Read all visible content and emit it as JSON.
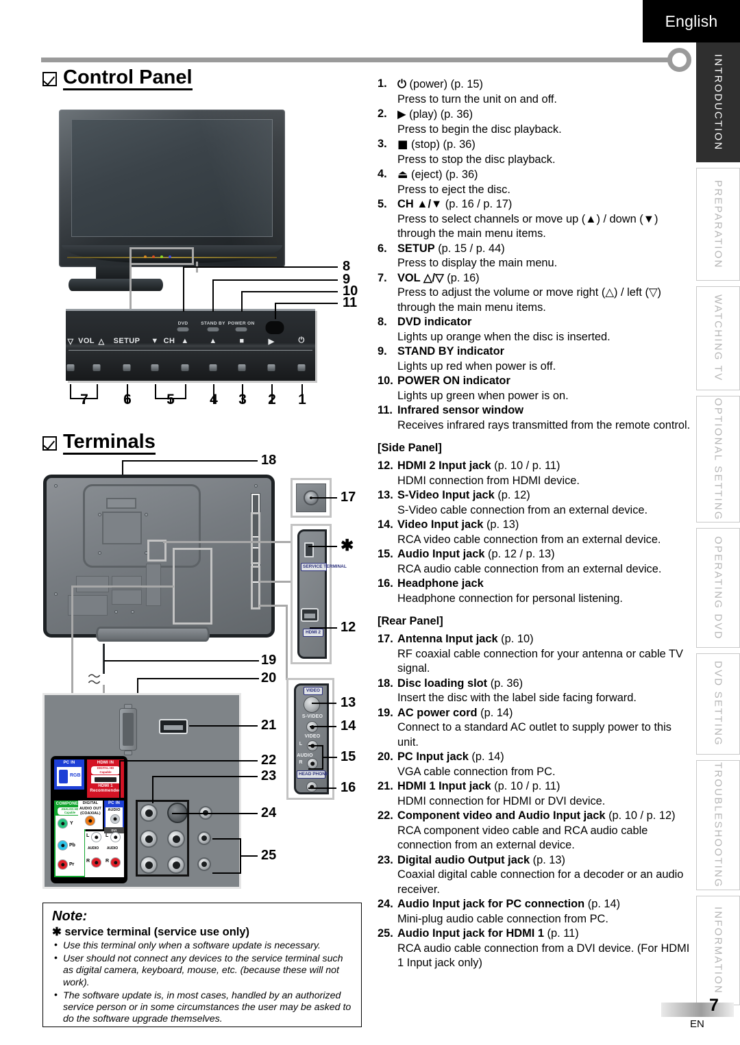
{
  "header": {
    "language": "English"
  },
  "rail": {
    "tabs": [
      {
        "label": "INTRODUCTION",
        "active": true
      },
      {
        "label": "PREPARATION",
        "active": false
      },
      {
        "label": "WATCHING TV",
        "active": false
      },
      {
        "label": "OPTIONAL  SETTING",
        "active": false
      },
      {
        "label": "OPERATING DVD",
        "active": false
      },
      {
        "label": "DVD SETTING",
        "active": false
      },
      {
        "label": "TROUBLESHOOTING",
        "active": false
      },
      {
        "label": "INFORMATION",
        "active": false
      }
    ]
  },
  "sections": {
    "control_panel_title": "Control Panel",
    "terminals_title": "Terminals"
  },
  "control_panel_diagram": {
    "button_labels": [
      "VOL",
      "SETUP",
      "CH"
    ],
    "vol_down_glyph": "▽",
    "vol_up_glyph": "△",
    "setup_label": "SETUP",
    "ch_down_glyph": "▼",
    "ch_label": "CH",
    "ch_up_glyph": "▲",
    "eject_glyph": "▲",
    "stop_glyph": "■",
    "play_glyph": "▶",
    "power_glyph": "⏻",
    "indicators": [
      "DVD",
      "STAND BY",
      "POWER ON"
    ],
    "bottom_numbers": [
      "7",
      "6",
      "5",
      "4",
      "3",
      "2",
      "1"
    ],
    "right_callouts": [
      "8",
      "9",
      "10",
      "11"
    ]
  },
  "terminals_diagram": {
    "callouts": [
      "18",
      "17",
      "19",
      "20",
      "13",
      "14",
      "15",
      "16",
      "12",
      "21",
      "22",
      "23",
      "24",
      "25"
    ],
    "asterisk": "✱",
    "side_tags": [
      "SERVICE TERMINAL",
      "HDMI 2",
      "VIDEO",
      "HEAD PHONE"
    ],
    "side_labels": [
      "S-VIDEO",
      "VIDEO",
      "AUDIO",
      "L",
      "R"
    ],
    "sticker": {
      "pc_in": "PC IN",
      "rgb": "RGB",
      "hdmi_in": "HDMI IN",
      "hdmi_sub": "DIGITAL HD Capable",
      "hdmi_1": "HDMI 1",
      "recommended": "Recommended",
      "component": "COMPONENT",
      "component_sub": "ANALOG HD Capable",
      "digital_audio_out": "DIGITAL AUDIO OUT (COAXIAL)",
      "pc_in_audio_hd": "PC IN",
      "audio": "AUDIO",
      "analog_audio": "DVI ANALOG AUDIO",
      "y": "Y",
      "pb": "Pb",
      "pr": "Pr",
      "l": "L",
      "r": "R",
      "audio_small": "AUDIO"
    }
  },
  "list": {
    "items": [
      {
        "num": "1.",
        "title": "⏻",
        "title_is_glyph": true,
        "suffix": " (power) (p. 15)",
        "desc": "Press to turn the unit on and off."
      },
      {
        "num": "2.",
        "title": "▶",
        "title_is_glyph": true,
        "suffix": " (play) (p. 36)",
        "desc": "Press to begin the disc playback."
      },
      {
        "num": "3.",
        "title": "■",
        "title_is_glyph": true,
        "suffix": " (stop) (p. 36)",
        "desc": "Press to stop the disc playback."
      },
      {
        "num": "4.",
        "title": "⏏",
        "title_is_glyph": true,
        "suffix": " (eject) (p. 36)",
        "desc": "Press to eject the disc."
      },
      {
        "num": "5.",
        "title": "CH ▲/▼",
        "suffix": " (p. 16 / p. 17)",
        "desc": "Press to select channels or move up (▲) / down (▼) through the main menu items."
      },
      {
        "num": "6.",
        "title": "SETUP",
        "suffix": " (p. 15 / p. 44)",
        "desc": "Press to display the main menu."
      },
      {
        "num": "7.",
        "title": "VOL △/▽",
        "suffix": " (p. 16)",
        "desc": "Press to adjust the volume or move right (△) / left (▽) through the main menu items."
      },
      {
        "num": "8.",
        "title": "DVD indicator",
        "suffix": "",
        "desc": "Lights up orange when the disc is inserted."
      },
      {
        "num": "9.",
        "title": "STAND BY indicator",
        "suffix": "",
        "desc": "Lights up red when power is off."
      },
      {
        "num": "10.",
        "title": "POWER ON indicator",
        "suffix": "",
        "desc": "Lights up green when power is on."
      },
      {
        "num": "11.",
        "title": "Infrared sensor window",
        "suffix": "",
        "desc": "Receives infrared rays transmitted from the remote control."
      }
    ],
    "side_panel_heading": "[Side Panel]",
    "side_items": [
      {
        "num": "12.",
        "title": "HDMI 2 Input jack",
        "suffix": " (p. 10 / p. 11)",
        "desc": "HDMI connection from HDMI device."
      },
      {
        "num": "13.",
        "title": "S-Video Input jack",
        "suffix": " (p. 12)",
        "desc": "S-Video cable connection from an external device."
      },
      {
        "num": "14.",
        "title": "Video Input jack",
        "suffix": " (p. 13)",
        "desc": "RCA video cable connection from an external device."
      },
      {
        "num": "15.",
        "title": "Audio Input jack",
        "suffix": " (p. 12 / p. 13)",
        "desc": "RCA audio cable connection from an external device."
      },
      {
        "num": "16.",
        "title": "Headphone jack",
        "suffix": "",
        "desc": "Headphone connection for personal listening."
      }
    ],
    "rear_panel_heading": "[Rear Panel]",
    "rear_items": [
      {
        "num": "17.",
        "title": "Antenna Input jack",
        "suffix": " (p. 10)",
        "desc": "RF coaxial cable connection for your antenna or cable TV signal."
      },
      {
        "num": "18.",
        "title": "Disc loading slot",
        "suffix": " (p. 36)",
        "desc": "Insert the disc with the label side facing forward."
      },
      {
        "num": "19.",
        "title": "AC power cord",
        "suffix": " (p. 14)",
        "desc": "Connect to a standard AC outlet to supply power to this unit."
      },
      {
        "num": "20.",
        "title": "PC Input jack",
        "suffix": " (p. 14)",
        "desc": "VGA cable connection from PC."
      },
      {
        "num": "21.",
        "title": "HDMI 1 Input jack",
        "suffix": " (p. 10 / p. 11)",
        "desc": "HDMI connection for HDMI or DVI device."
      },
      {
        "num": "22.",
        "title": "Component video and Audio Input jack",
        "suffix": " (p. 10 / p. 12)",
        "desc": "RCA component video cable and RCA audio cable connection from an external device."
      },
      {
        "num": "23.",
        "title": "Digital audio Output jack",
        "suffix": " (p. 13)",
        "desc": "Coaxial digital cable connection for a decoder or an audio receiver."
      },
      {
        "num": "24.",
        "title": "Audio Input jack for PC connection",
        "suffix": " (p. 14)",
        "desc": "Mini-plug audio cable connection from PC."
      },
      {
        "num": "25.",
        "title": "Audio Input jack for HDMI 1",
        "suffix": " (p. 11)",
        "desc": "RCA audio cable connection from a DVI device. (For HDMI 1 Input jack only)"
      }
    ]
  },
  "note": {
    "heading": "Note:",
    "subheading": "✱ service terminal (service use only)",
    "bullets": [
      "Use this terminal only when a software update is necessary.",
      "User should not connect any devices to the service terminal such as digital camera, keyboard, mouse, etc. (because these will not work).",
      "The software update is, in most cases, handled by an authorized  service person or in some circumstances the user may be asked to do the software upgrade themselves."
    ]
  },
  "footer": {
    "page": "7",
    "lang_code": "EN"
  }
}
